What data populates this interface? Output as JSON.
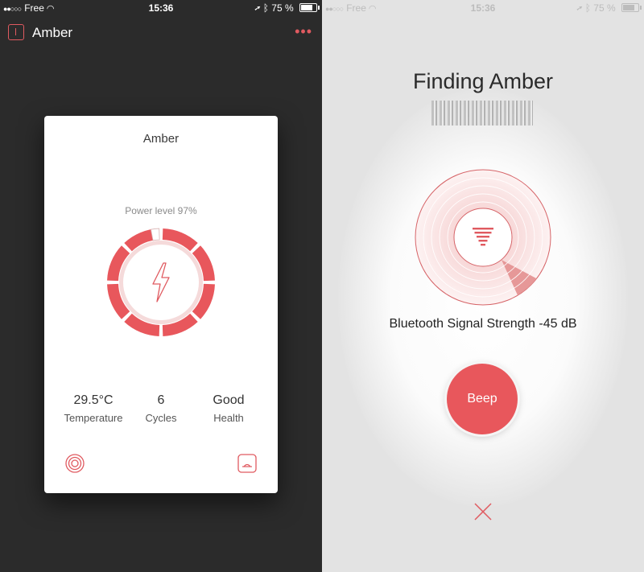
{
  "status_bar": {
    "signal_dots": "●●○○○",
    "carrier": "Free",
    "time": "15:36",
    "battery_text": "75 %"
  },
  "left_screen": {
    "app_title": "Amber",
    "more_label": "•••",
    "card": {
      "title": "Amber",
      "power_label": "Power level 97%",
      "power_level": 0.97,
      "stats": [
        {
          "value": "29.5°C",
          "label": "Temperature"
        },
        {
          "value": "6",
          "label": "Cycles"
        },
        {
          "value": "Good",
          "label": "Health"
        }
      ]
    }
  },
  "right_screen": {
    "title": "Finding Amber",
    "signal_text": "Bluetooth Signal Strength -45 dB",
    "beep_label": "Beep"
  },
  "colors": {
    "accent": "#e8575c",
    "dark_bg": "#2b2b2b",
    "light_bg": "#e3e3e3"
  },
  "icons": [
    "location-arrow-icon",
    "bluetooth-icon",
    "lightning-bolt-icon",
    "target-icon",
    "device-icon",
    "signal-strength-icon",
    "close-icon"
  ]
}
